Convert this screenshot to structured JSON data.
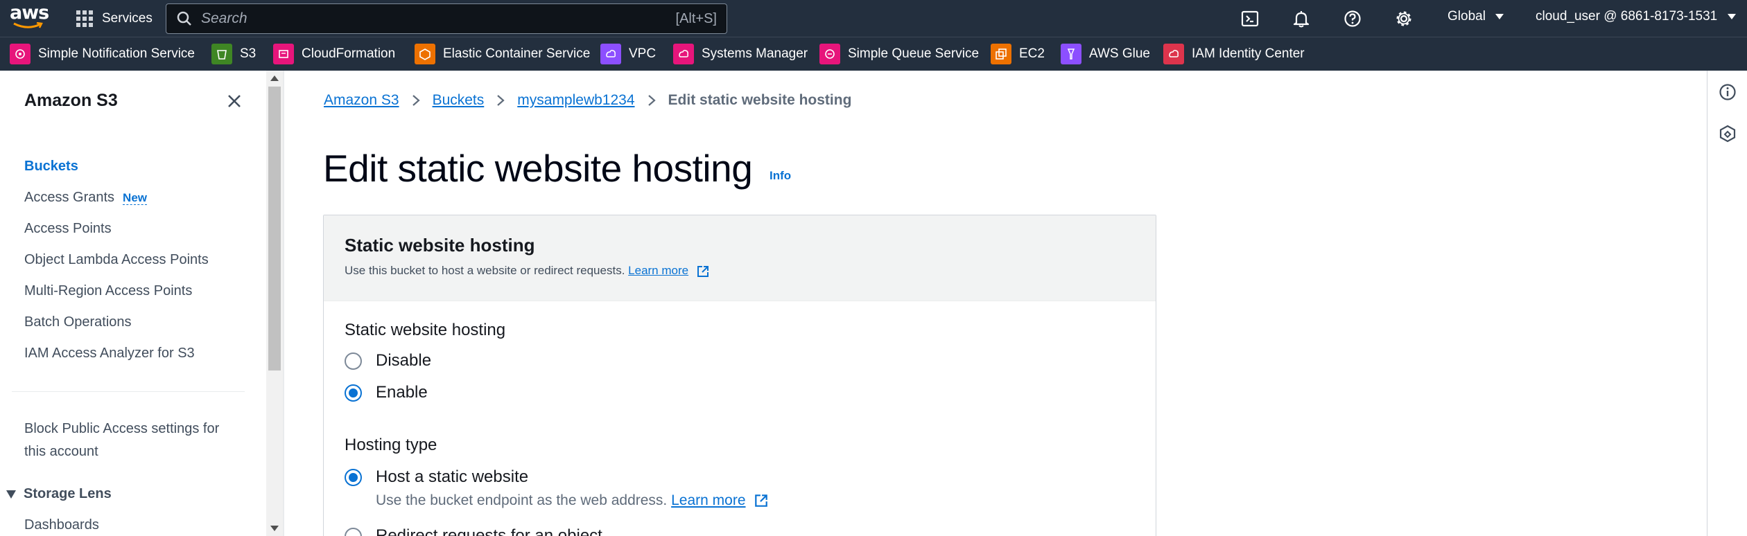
{
  "topnav": {
    "logo_text": "aws",
    "services_label": "Services",
    "search_placeholder": "Search",
    "search_shortcut": "[Alt+S]",
    "region_label": "Global",
    "account_label": "cloud_user @ 6861-8173-1531",
    "icons": [
      "cloudshell-icon",
      "notifications-icon",
      "help-icon",
      "settings-icon"
    ]
  },
  "favorites": [
    {
      "label": "Simple Notification Service",
      "color": "#e7157b"
    },
    {
      "label": "S3",
      "color": "#3f8624"
    },
    {
      "label": "CloudFormation",
      "color": "#e7157b"
    },
    {
      "label": "Elastic Container Service",
      "color": "#ed7100"
    },
    {
      "label": "VPC",
      "color": "#8c4fff"
    },
    {
      "label": "Systems Manager",
      "color": "#e7157b"
    },
    {
      "label": "Simple Queue Service",
      "color": "#e7157b"
    },
    {
      "label": "EC2",
      "color": "#ed7100"
    },
    {
      "label": "AWS Glue",
      "color": "#8c4fff"
    },
    {
      "label": "IAM Identity Center",
      "color": "#dd344c"
    }
  ],
  "sidebar": {
    "title": "Amazon S3",
    "items": [
      {
        "label": "Buckets",
        "active": true
      },
      {
        "label": "Access Grants",
        "badge": "New"
      },
      {
        "label": "Access Points"
      },
      {
        "label": "Object Lambda Access Points"
      },
      {
        "label": "Multi-Region Access Points"
      },
      {
        "label": "Batch Operations"
      },
      {
        "label": "IAM Access Analyzer for S3"
      }
    ],
    "block_public_line1": "Block Public Access settings for",
    "block_public_line2": "this account",
    "section_storage_lens": "Storage Lens",
    "dashboards": "Dashboards"
  },
  "breadcrumb": {
    "items": [
      "Amazon S3",
      "Buckets",
      "mysamplewb1234"
    ],
    "current": "Edit static website hosting"
  },
  "page": {
    "title": "Edit static website hosting",
    "info_label": "Info"
  },
  "panel": {
    "header_title": "Static website hosting",
    "header_desc": "Use this bucket to host a website or redirect requests.",
    "learn_more": "Learn more",
    "hosting_label": "Static website hosting",
    "hosting_options": [
      {
        "label": "Disable",
        "selected": false
      },
      {
        "label": "Enable",
        "selected": true
      }
    ],
    "hosting_type_label": "Hosting type",
    "hosting_type_options": [
      {
        "label": "Host a static website",
        "selected": true,
        "desc": "Use the bucket endpoint as the web address."
      },
      {
        "label": "Redirect requests for an object",
        "selected": false
      }
    ],
    "desc_learn_more": "Learn more"
  },
  "colors": {
    "nav_bg": "#232f3e",
    "link": "#0972d3",
    "panel_header_bg": "#f2f3f3"
  }
}
